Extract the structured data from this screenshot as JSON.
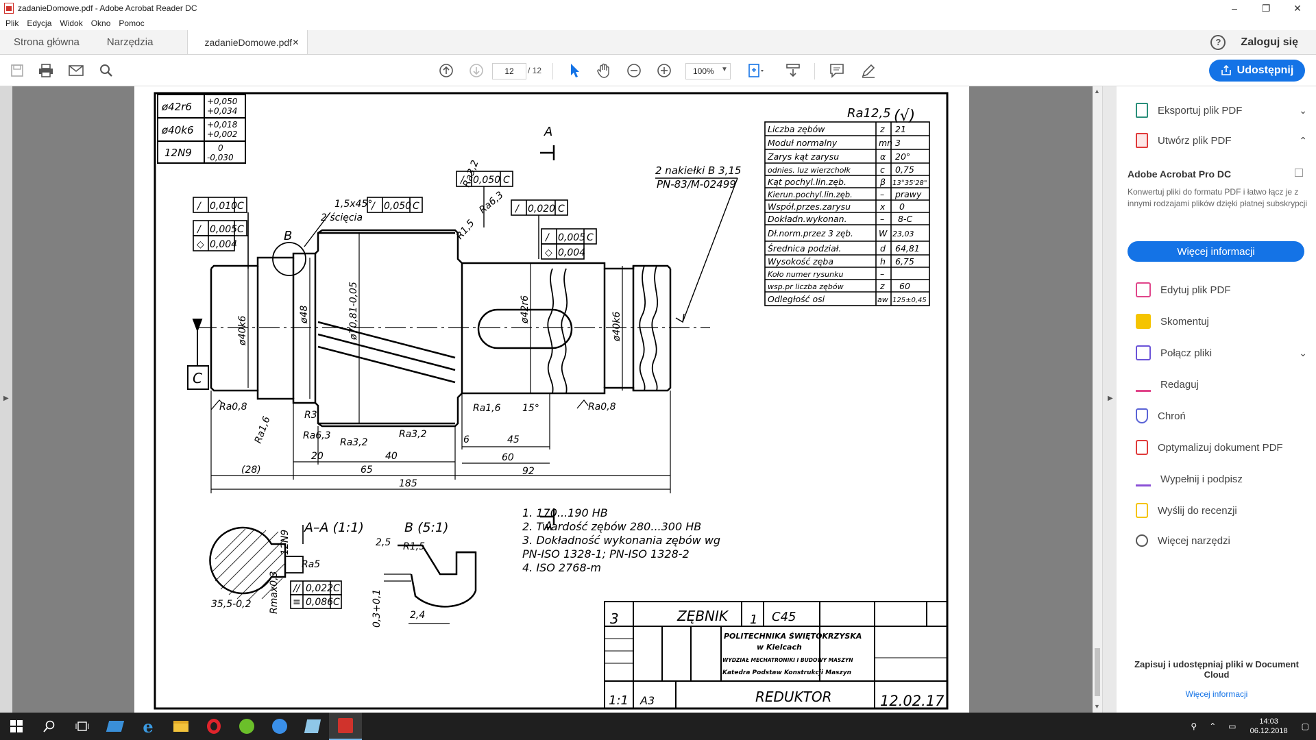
{
  "window": {
    "title": "zadanieDomowe.pdf - Adobe Acrobat Reader DC",
    "minimize": "–",
    "maximize": "❐",
    "close": "✕"
  },
  "menu": [
    "Plik",
    "Edycja",
    "Widok",
    "Okno",
    "Pomoc"
  ],
  "tabs": {
    "home": "Strona główna",
    "tools": "Narzędzia",
    "document": "zadanieDomowe.pdf",
    "document_close": "✕"
  },
  "header": {
    "help": "?",
    "signin": "Zaloguj się"
  },
  "toolbar": {
    "page_current": "12",
    "page_total": "/ 12",
    "zoom": "100%",
    "share": "Udostępnij"
  },
  "right_panel": {
    "export": "Eksportuj plik PDF",
    "create": "Utwórz plik PDF",
    "promo_title": "Adobe Acrobat Pro DC",
    "promo_text": "Konwertuj pliki do formatu PDF i łatwo łącz je z innymi rodzajami plików dzięki płatnej subskrypcji",
    "promo_button": "Więcej informacji",
    "items": [
      {
        "label": "Edytuj plik PDF",
        "color": "#e0458a"
      },
      {
        "label": "Skomentuj",
        "color": "#f5c400"
      },
      {
        "label": "Połącz pliki",
        "color": "#6b53d8"
      },
      {
        "label": "Redaguj",
        "color": "#e0458a"
      },
      {
        "label": "Chroń",
        "color": "#5a63d6"
      },
      {
        "label": "Optymalizuj dokument PDF",
        "color": "#e03a3a"
      },
      {
        "label": "Wypełnij i podpisz",
        "color": "#8a4fd6"
      },
      {
        "label": "Wyślij do recenzji",
        "color": "#f5c400"
      },
      {
        "label": "Więcej narzędzi",
        "color": "#555555"
      }
    ],
    "footer": "Zapisuj i udostępniaj pliki w Document Cloud",
    "footer_link": "Więcej informacji"
  },
  "drawing": {
    "fits": [
      {
        "dim": "ø42r6",
        "upper": "+0,050",
        "lower": "+0,034"
      },
      {
        "dim": "ø40k6",
        "upper": "+0,018",
        "lower": "+0,002"
      },
      {
        "dim": "12N9",
        "upper": "0",
        "lower": "-0,030"
      }
    ],
    "roughness_general": "Ra12,5",
    "section_mark": "A",
    "datum": "C",
    "callouts": {
      "runout1": "0,010",
      "runout2": "0,005",
      "cyl1": "0,004",
      "runout3": "0,050",
      "runout4": "0,050",
      "runout5": "0,020",
      "runout6": "0,005",
      "cyl2": "0,004",
      "chamfer": "1,5x45°",
      "chamfer_note": "2 ścięcia",
      "detail_b": "B",
      "centers_note1": "2 nakiełki B 3,15",
      "centers_note2": "PN-83/M-02499"
    },
    "diameters": [
      "ø40k6",
      "ø48",
      "ø70,81-0,05",
      "ø42r6",
      "ø40k6"
    ],
    "roughness_marks": [
      "Ra0,8",
      "Ra1,6",
      "R3",
      "Ra6,3",
      "Ra3,2",
      "Ra3,2",
      "Ra1,6",
      "15°",
      "Ra0,8",
      "Ra3,2",
      "Ra6,3",
      "R1,5"
    ],
    "dimensions": [
      "20",
      "40",
      "6",
      "45",
      "60",
      "(28)",
      "65",
      "92",
      "185"
    ],
    "gear_table": [
      [
        "Liczba zębów",
        "z",
        "21"
      ],
      [
        "Moduł normalny",
        "mn",
        "3"
      ],
      [
        "Zarys kąt zarysu",
        "α",
        "20°"
      ],
      [
        "odnies. luz wierzchołk",
        "c",
        "0,75"
      ],
      [
        "Kąt pochyl.lin.zęb.",
        "β",
        "13°35'28\""
      ],
      [
        "Kierun.pochyl.lin.zęb.",
        "–",
        "prawy"
      ],
      [
        "Współ.przes.zarysu",
        "x",
        "0"
      ],
      [
        "Dokładn.wykonan.",
        "–",
        "8-C"
      ],
      [
        "Dł.norm.przez 3 zęb.",
        "W",
        "23,03"
      ],
      [
        "Średnica podział.",
        "d",
        "64,81"
      ],
      [
        "Wysokość zęba",
        "h",
        "6,75"
      ],
      [
        "Koło numer rysunku",
        "–",
        ""
      ],
      [
        "wsp.pr liczba zębów",
        "z",
        "60"
      ],
      [
        "Odległość osi",
        "aw",
        "125±0,45"
      ]
    ],
    "section_title": "A–A (1:1)",
    "detail_title": "B (5:1)",
    "section_dims": [
      "12N9",
      "Ra5",
      "35,5-0,2",
      "Rmax0,3"
    ],
    "section_tol": [
      "0,022",
      "0,086"
    ],
    "detail_dims": [
      "2,5",
      "R1,5",
      "0,3+0,1",
      "2,4"
    ],
    "notes": [
      "1.  170...190 HB",
      "2.  Twardość zębów  280...300  HB",
      "3.  Dokładność wykonania zębów wg",
      "     PN-ISO  1328-1;    PN-ISO  1328-2",
      "4.  ISO  2768-m"
    ],
    "title_block": {
      "part_no": "3",
      "part_name": "ZĘBNIK",
      "qty": "1",
      "material": "C45",
      "school": "POLITECHNIKA ŚWIĘTOKRZYSKA",
      "city": "w Kielcach",
      "faculty": "WYDZIAŁ MECHATRONIKI I BUDOWY MASZYN",
      "dept": "Katedra Podstaw Konstrukcji Maszyn",
      "scale": "1:1",
      "format": "A3",
      "assembly": "REDUKTOR",
      "drawing_no": "12.02.17"
    }
  },
  "taskbar": {
    "time": "14:03",
    "date": "06.12.2018"
  }
}
